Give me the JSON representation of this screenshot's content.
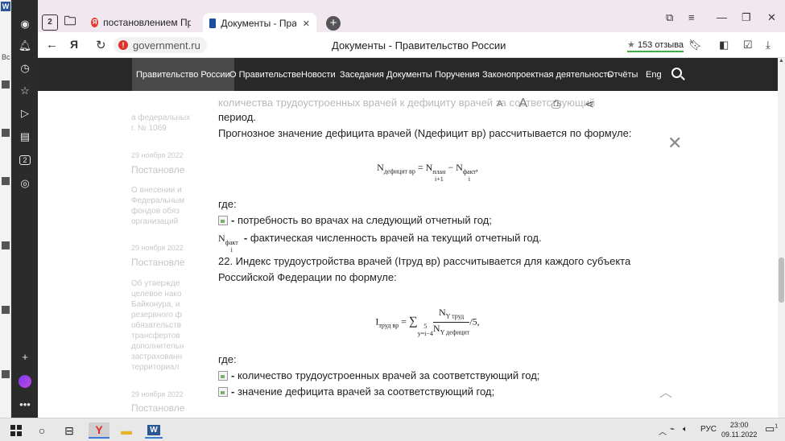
{
  "browser": {
    "tabs": [
      {
        "label": "постановлением Правите",
        "favicon": "yandex-icon"
      },
      {
        "label": "Документы - Правителл",
        "favicon": "government-icon",
        "active": true
      }
    ],
    "tab_group_count": "2",
    "sidebar_badge": "2",
    "address": {
      "domain": "government.ru",
      "page_title": "Документы - Правительство России",
      "reviews": "153 отзыва",
      "reviews_star": "★"
    }
  },
  "site_nav": {
    "items": [
      "Правительство России",
      "О Правительстве",
      "Новости",
      "Заседания",
      "Документы",
      "Поручения",
      "Законопроектная деятельность",
      "Отчёты",
      "Eng"
    ]
  },
  "background_column": {
    "lines": [
      "а федеральных",
      "г. № 1069",
      "29 ноября 2022",
      "Постановле",
      "О внесении и",
      "Федеральным",
      "фондов обяз",
      "организаций",
      "29 ноября 2022",
      "Постановле",
      "Об утвержде",
      "целевое нако",
      "Байконура, и",
      "резервного ф",
      "обязательств",
      "трансфертов",
      "дополнительн",
      "застрахованн",
      "территориал",
      "29 ноября 2022",
      "Постановле"
    ]
  },
  "document": {
    "line_top_faded": "количества трудоустроенных врачей к дефициту врачей за соответствующий",
    "line_period": "период.",
    "para_forecast": "Прогнозное значение дефицита врачей (Nдефицит вр) рассчитывается по формуле:",
    "formula1": {
      "lhs": "N",
      "lhs_sub": "дефицит  вр",
      "eq": " = ",
      "n1": "N",
      "n1_sup": "план",
      "n1_sub": "i+1",
      "minus": " − ",
      "n2": "N",
      "n2_sup": "факт",
      "n2_sub": "i",
      "tail": ","
    },
    "where1": "где:",
    "item_need": "потребность во врачах на следующий отчетный год;",
    "item_fact_symbol": "N",
    "item_fact_sup": "факт",
    "item_fact_sub": "i",
    "item_fact": "фактическая численность врачей на текущий отчетный год.",
    "item_dash": "-",
    "para_22": "22. Индекс трудоустройства врачей (Iтруд вр) рассчитывается для каждого субъекта Российской Федерации по формуле:",
    "formula2": {
      "lhs": "I",
      "lhs_sub": "труд вр",
      "eq": " = ",
      "sum": "∑",
      "sum_sup": "5",
      "sum_sub": "y=i−4",
      "num": "N",
      "num_sub": "Y труд",
      "den": "N",
      "den_sub": "Y  дефицит",
      "tail": "/5,"
    },
    "where2": "где:",
    "item_employed": "количество трудоустроенных врачей за соответствующий год;",
    "item_deficit": "значение дефицита врачей за соответствующий год;"
  },
  "taskbar": {
    "lang": "РУС",
    "time": "23:00",
    "date": "09.11.2022",
    "notif_count": "1"
  }
}
